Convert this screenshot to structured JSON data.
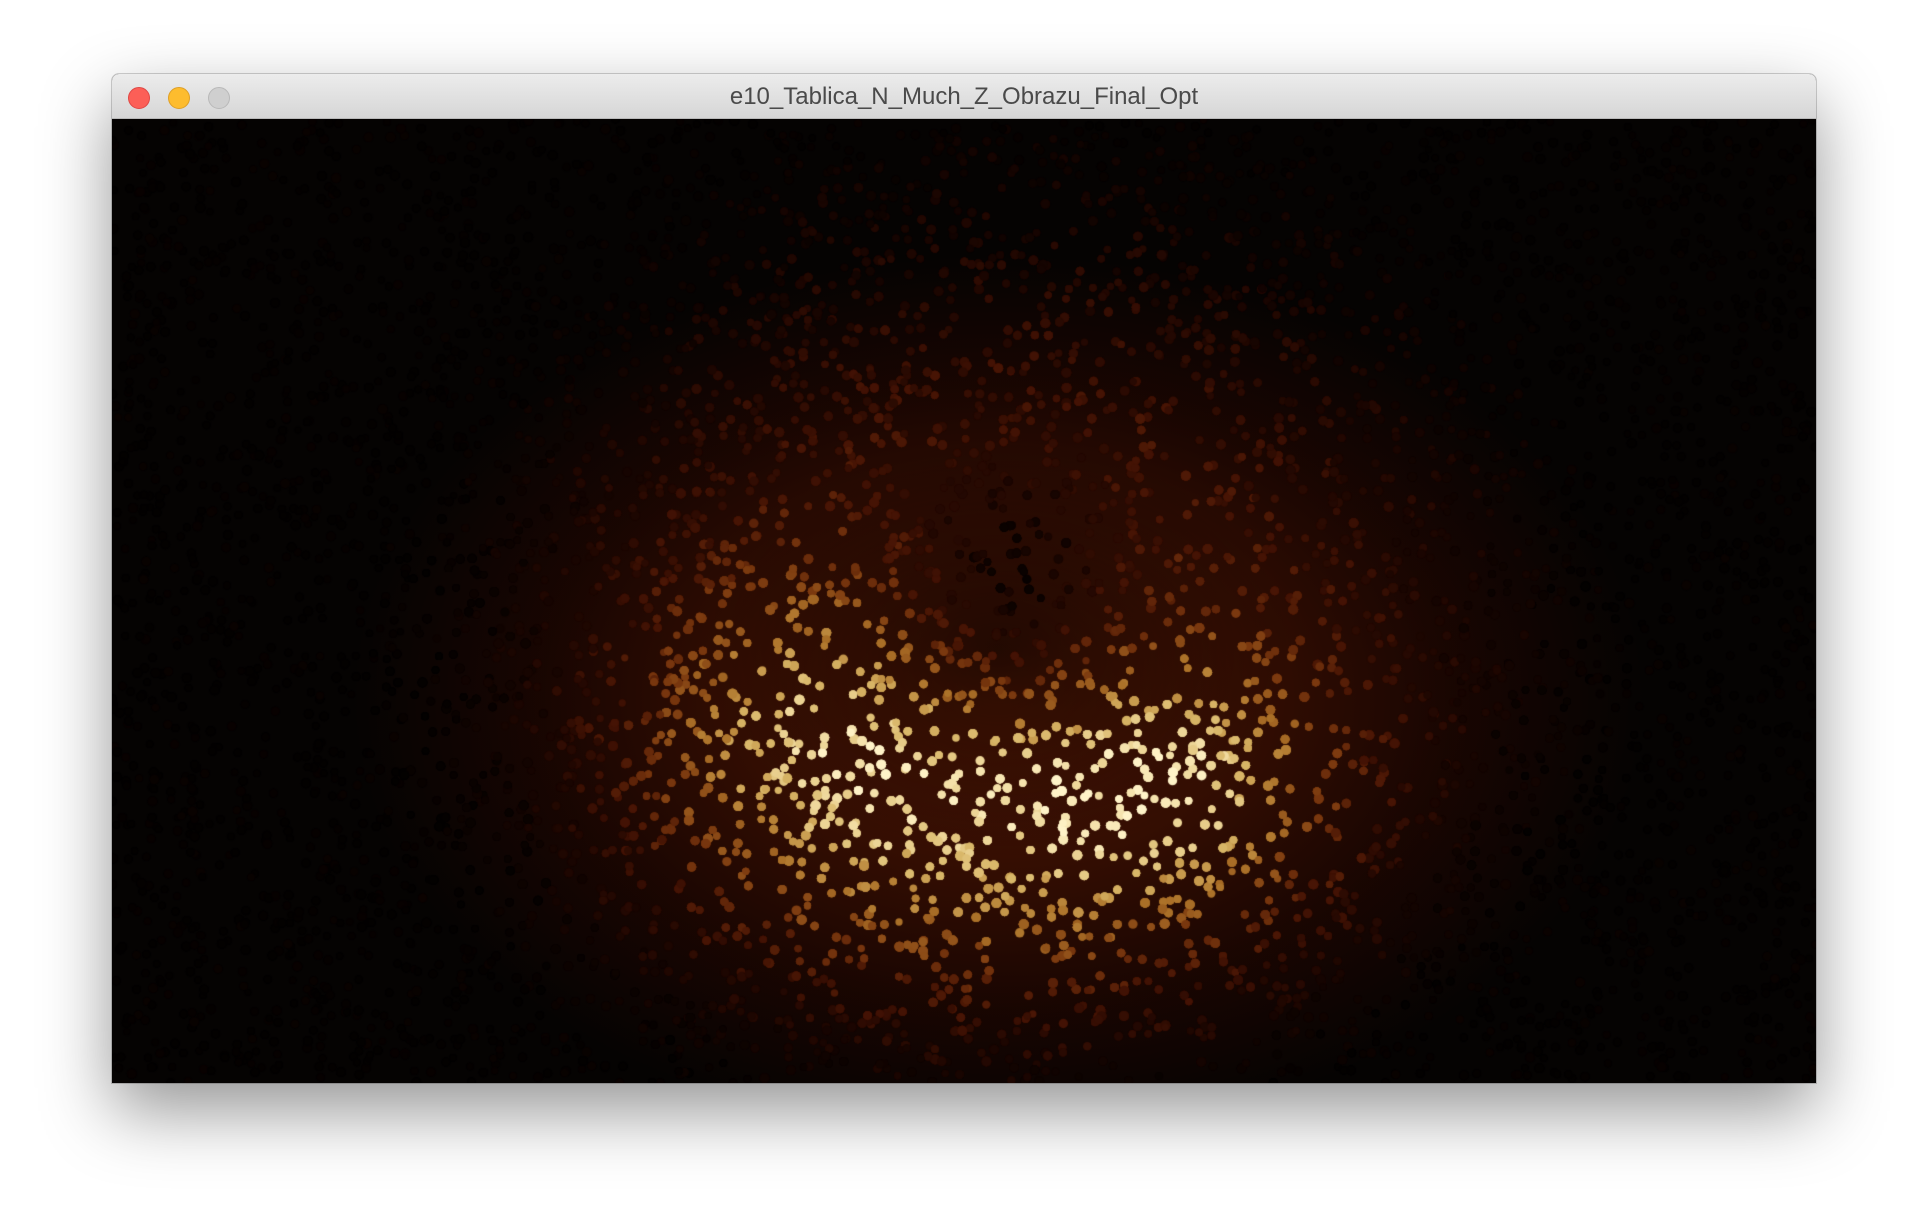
{
  "window": {
    "title": "e10_Tablica_N_Much_Z_Obrazu_Final_Opt",
    "controls": {
      "close": "close-icon",
      "minimize": "minimize-icon",
      "zoom": "zoom-icon"
    }
  },
  "canvas": {
    "description_icon": "particle-canvas",
    "background_color": "#050302",
    "palette": [
      "#2a0800",
      "#6e1604",
      "#b0300a",
      "#e0661a",
      "#f7a33a",
      "#ffd77a",
      "#fff3c8"
    ]
  }
}
